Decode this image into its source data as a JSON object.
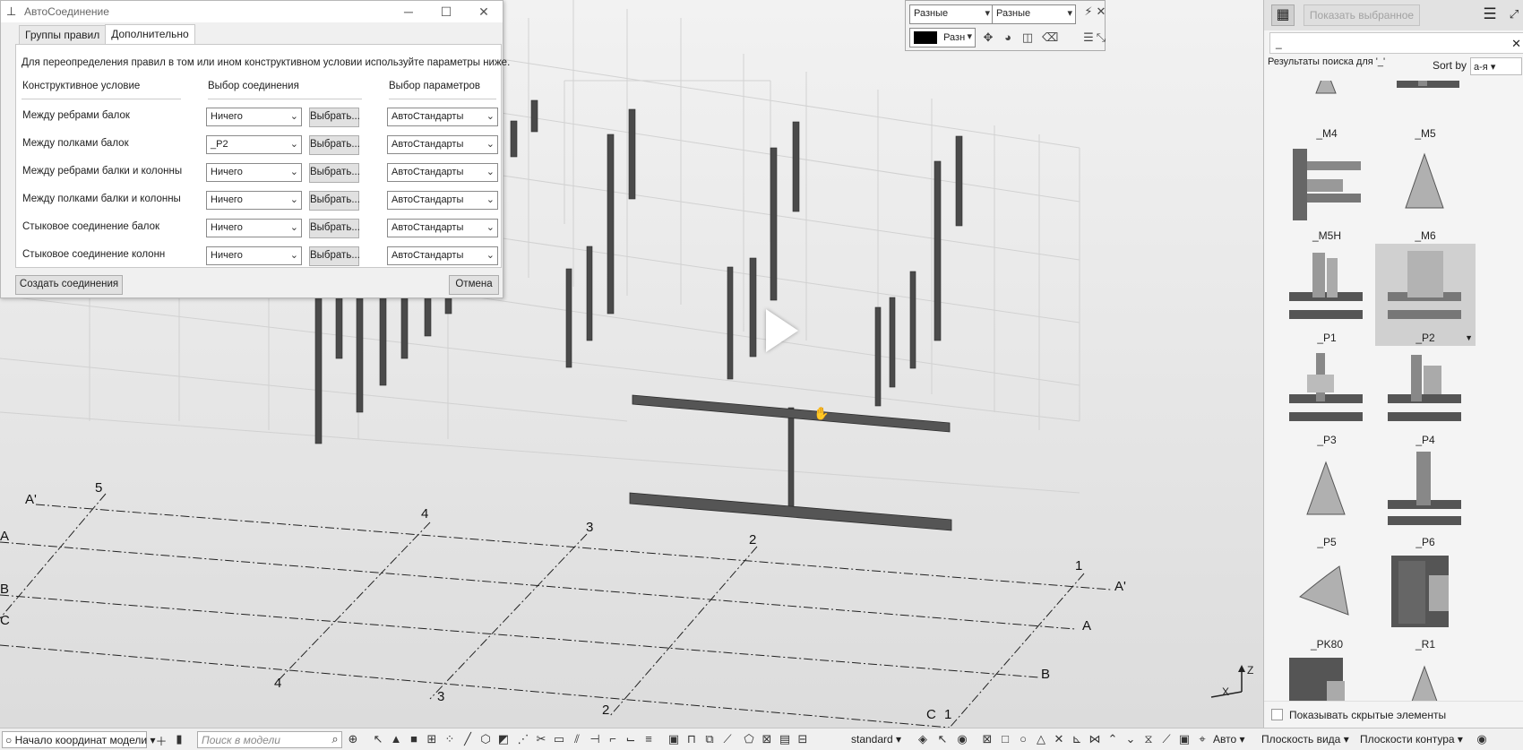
{
  "dialog": {
    "title": "АвтоСоединение",
    "tabs": [
      "Группы правил",
      "Дополнительно"
    ],
    "intro": "Для переопределения правил в том или ином конструктивном условии используйте параметры ниже.",
    "columns": {
      "condition": "Конструктивное условие",
      "connection": "Выбор соединения",
      "params": "Выбор параметров"
    },
    "rows": [
      {
        "label": "Между ребрами балок",
        "connection": "Ничего",
        "pick": "Выбрать...",
        "params": "АвтоСтандарты"
      },
      {
        "label": "Между полками балок",
        "connection": "_P2",
        "pick": "Выбрать...",
        "params": "АвтоСтандарты"
      },
      {
        "label": "Между ребрами балки и колонны",
        "connection": "Ничего",
        "pick": "Выбрать...",
        "params": "АвтоСтандарты"
      },
      {
        "label": "Между полками балки и колонны",
        "connection": "Ничего",
        "pick": "Выбрать...",
        "params": "АвтоСтандарты"
      },
      {
        "label": "Стыковое соединение балок",
        "connection": "Ничего",
        "pick": "Выбрать...",
        "params": "АвтоСтандарты"
      },
      {
        "label": "Стыковое соединение колонн",
        "connection": "Ничего",
        "pick": "Выбрать...",
        "params": "АвтоСтандарты"
      }
    ],
    "create_button": "Создать соединения",
    "cancel_button": "Отмена"
  },
  "control_panel": {
    "select1": "Разные",
    "select2": "Разные",
    "color_select": "Разн"
  },
  "grid_labels": [
    {
      "text": "A'"
    },
    {
      "text": "5"
    },
    {
      "text": "4"
    },
    {
      "text": "3"
    },
    {
      "text": "2"
    },
    {
      "text": "1"
    },
    {
      "text": "A"
    },
    {
      "text": "B"
    },
    {
      "text": "C"
    },
    {
      "text": "A'"
    },
    {
      "text": "A"
    },
    {
      "text": "B"
    },
    {
      "text": "C"
    },
    {
      "text": "4"
    },
    {
      "text": "3"
    },
    {
      "text": "2"
    },
    {
      "text": "1"
    }
  ],
  "axes": {
    "z": "Z",
    "x": "X"
  },
  "sidebar": {
    "show_selected": "Показать выбранное",
    "search_value": "_",
    "results_label": "Результаты поиска для '_'",
    "sort_by": "Sort by",
    "sort_value": "а-я",
    "items": [
      {
        "name": "_M4",
        "icon": "joint-icon"
      },
      {
        "name": "_M5",
        "icon": "joint-icon"
      },
      {
        "name": "_M5H",
        "icon": "joint-icon"
      },
      {
        "name": "_M6",
        "icon": "triangle-icon"
      },
      {
        "name": "_P1",
        "icon": "joint-icon"
      },
      {
        "name": "_P2",
        "icon": "joint-icon"
      },
      {
        "name": "_P3",
        "icon": "joint-icon"
      },
      {
        "name": "_P4",
        "icon": "joint-icon"
      },
      {
        "name": "_P5",
        "icon": "triangle-icon"
      },
      {
        "name": "_P6",
        "icon": "joint-icon"
      },
      {
        "name": "_PK80",
        "icon": "sector-icon"
      },
      {
        "name": "_R1",
        "icon": "joint-icon"
      },
      {
        "name": "",
        "icon": "joint-icon"
      },
      {
        "name": "",
        "icon": "triangle-icon"
      }
    ],
    "show_hidden": "Показывать скрытые элементы"
  },
  "statusbar": {
    "origin": "Начало координат модели",
    "search_placeholder": "Поиск в модели",
    "standard": "standard",
    "auto": "Авто",
    "view_planes": "Плоскость вида",
    "contour_planes": "Плоскости контура"
  }
}
